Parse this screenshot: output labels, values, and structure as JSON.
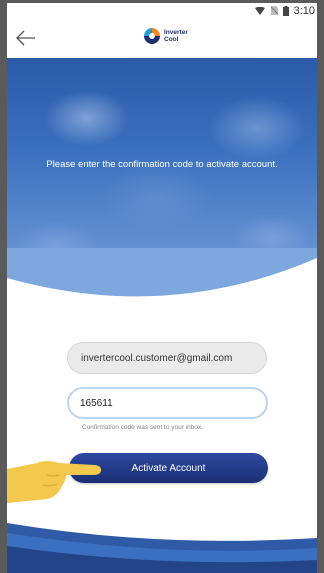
{
  "status_bar": {
    "time": "3:10"
  },
  "header": {
    "logo_line1": "Inverter",
    "logo_line2": "Cool"
  },
  "hero": {
    "message": "Please enter the confirmation code to activate account."
  },
  "form": {
    "email_value": "invertercool.customer@gmail.com",
    "code_value": "165611",
    "hint": "Confirmation code was sent to your inbox.",
    "activate_label": "Activate Account"
  },
  "colors": {
    "button": "#1f3580",
    "hero": "#3a6fbe",
    "hand": "#f2c94c"
  }
}
